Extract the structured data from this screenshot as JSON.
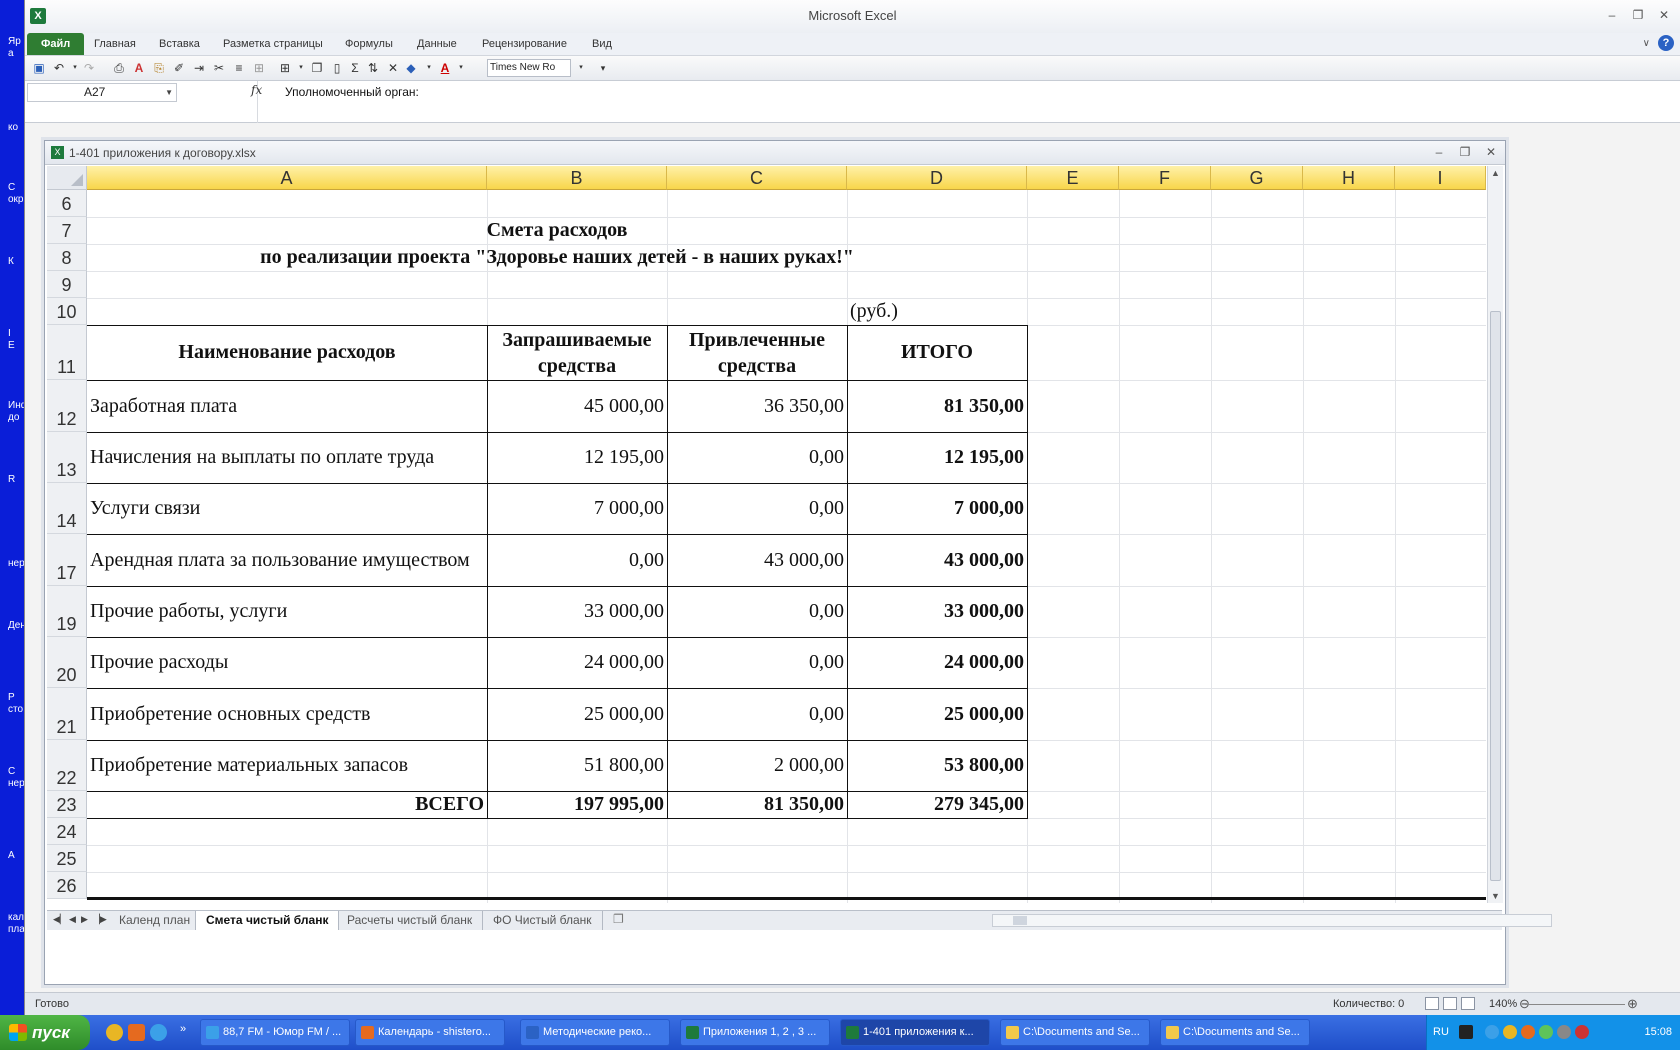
{
  "app": {
    "title": "Microsoft Excel",
    "ribbon_tabs": [
      "Файл",
      "Главная",
      "Вставка",
      "Разметка страницы",
      "Формулы",
      "Данные",
      "Рецензирование",
      "Вид"
    ],
    "font_name": "Times New Ro"
  },
  "formula_bar": {
    "cell_ref": "A27",
    "fx": "fx",
    "content": "Уполномоченный орган:"
  },
  "workbook": {
    "filename": "1-401 приложения к договору.xlsx"
  },
  "grid": {
    "columns": [
      "A",
      "B",
      "C",
      "D",
      "E",
      "F",
      "G",
      "H",
      "I"
    ],
    "rows": [
      "6",
      "7",
      "8",
      "9",
      "10",
      "11",
      "12",
      "13",
      "14",
      "17",
      "19",
      "20",
      "21",
      "22",
      "23",
      "24",
      "25",
      "26"
    ]
  },
  "sheet": {
    "title_line1": "Смета расходов",
    "title_line2": "по реализации проекта \"Здоровье наших детей - в наших руках!\"",
    "unit": "(руб.)",
    "headers": {
      "name": "Наименование расходов",
      "requested": "Запрашиваемые средства",
      "attracted": "Привлеченные средства",
      "total": "ИТОГО"
    },
    "rows": [
      {
        "name": "Заработная плата",
        "requested": "45 000,00",
        "attracted": "36 350,00",
        "total": "81 350,00"
      },
      {
        "name": "Начисления на выплаты по оплате труда",
        "requested": "12 195,00",
        "attracted": "0,00",
        "total": "12 195,00"
      },
      {
        "name": "Услуги связи",
        "requested": "7 000,00",
        "attracted": "0,00",
        "total": "7 000,00"
      },
      {
        "name": "Арендная плата за пользование имуществом",
        "requested": "0,00",
        "attracted": "43 000,00",
        "total": "43 000,00"
      },
      {
        "name": "Прочие работы, услуги",
        "requested": "33 000,00",
        "attracted": "0,00",
        "total": "33 000,00"
      },
      {
        "name": "Прочие расходы",
        "requested": "24 000,00",
        "attracted": "0,00",
        "total": "24 000,00"
      },
      {
        "name": "Приобретение основных средств",
        "requested": "25 000,00",
        "attracted": "0,00",
        "total": "25 000,00"
      },
      {
        "name": "Приобретение материальных запасов",
        "requested": "51 800,00",
        "attracted": "2 000,00",
        "total": "53 800,00"
      }
    ],
    "totals": {
      "label": "ВСЕГО",
      "requested": "197 995,00",
      "attracted": "81 350,00",
      "total": "279 345,00"
    }
  },
  "sheet_tabs": [
    "Календ план",
    "Смета чистый бланк",
    "Расчеты чистый бланк",
    "ФО Чистый бланк"
  ],
  "active_sheet_index": 1,
  "status": {
    "ready": "Готово",
    "count": "Количество: 0",
    "zoom": "140%"
  },
  "taskbar": {
    "start": "пуск",
    "tasks": [
      "88,7 FM - Юмор FM / ...",
      "Календарь - shistero...",
      "Методические реко...",
      "Приложения 1, 2 , 3 ...",
      "1-401 приложения к...",
      "C:\\Documents and Se...",
      "C:\\Documents and Se..."
    ],
    "active_task_index": 4,
    "lang": "RU",
    "clock": "15:08"
  },
  "desktop_labels": [
    "Яр",
    "а",
    "ко",
    "С",
    "окр",
    "К",
    "I",
    "Е",
    "Инф",
    "до",
    "R",
    "нер",
    "Ден",
    "Р",
    "сто",
    "С",
    "нер",
    "А",
    "кале",
    "пла"
  ],
  "colors": {
    "desktop": "#0a1ed8",
    "excel_green": "#2f7d32",
    "column_header": "#f8d64b",
    "taskbar": "#2a5fd6"
  }
}
